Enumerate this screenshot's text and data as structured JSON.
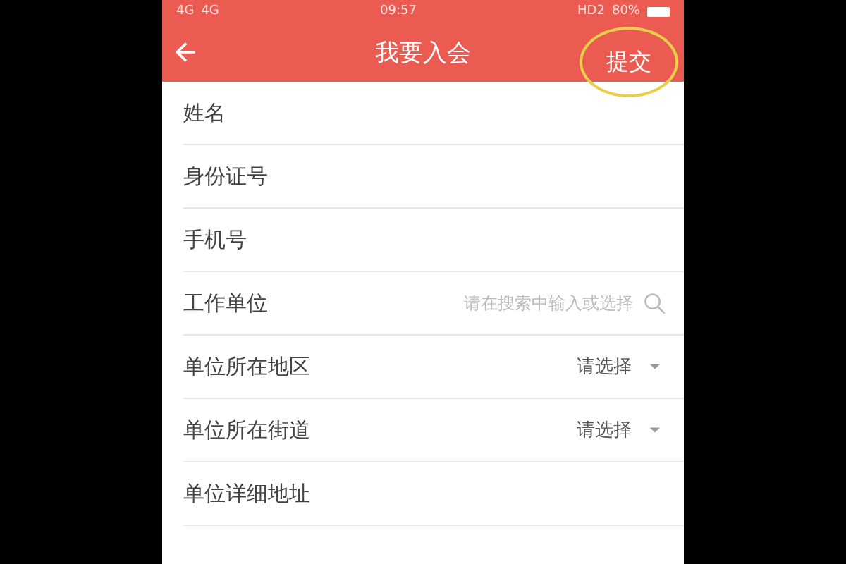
{
  "status_bar": {
    "signals": [
      "4G",
      "4G"
    ],
    "time": "09:57",
    "hd": "HD2",
    "battery": "80%"
  },
  "nav": {
    "title": "我要入会",
    "action": "提交",
    "action_highlighted": true
  },
  "fields": [
    {
      "label": "姓名",
      "kind": "text"
    },
    {
      "label": "身份证号",
      "kind": "text"
    },
    {
      "label": "手机号",
      "kind": "text"
    },
    {
      "label": "工作单位",
      "kind": "search",
      "placeholder": "请在搜索中输入或选择"
    },
    {
      "label": "单位所在地区",
      "kind": "select",
      "value": "请选择"
    },
    {
      "label": "单位所在街道",
      "kind": "select",
      "value": "请选择"
    },
    {
      "label": "单位详细地址",
      "kind": "text"
    }
  ]
}
